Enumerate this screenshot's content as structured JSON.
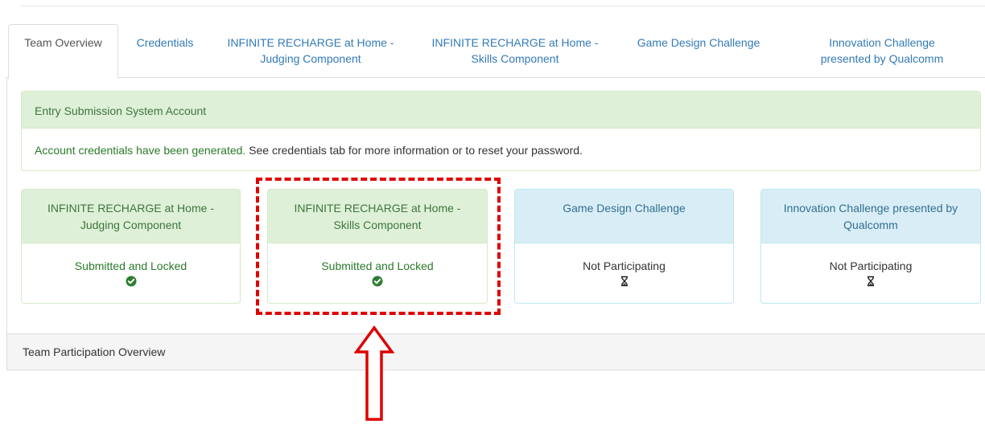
{
  "tabs": [
    {
      "line1": "Team Overview",
      "line2": ""
    },
    {
      "line1": "Credentials",
      "line2": ""
    },
    {
      "line1": "INFINITE RECHARGE at Home -",
      "line2": "Judging Component"
    },
    {
      "line1": "INFINITE RECHARGE at Home -",
      "line2": "Skills Component"
    },
    {
      "line1": "Game Design Challenge",
      "line2": ""
    },
    {
      "line1": "Innovation Challenge",
      "line2": "presented by Qualcomm"
    }
  ],
  "account_panel": {
    "heading": "Entry Submission System Account",
    "success_text": "Account credentials have been generated.",
    "info_text": " See credentials tab for more information or to reset your password."
  },
  "cards": [
    {
      "line1": "INFINITE RECHARGE at Home -",
      "line2": "Judging Component",
      "status": "Submitted and Locked",
      "icon": "check-circle-icon",
      "color": "#3c763d"
    },
    {
      "line1": "INFINITE RECHARGE at Home -",
      "line2": "Skills Component",
      "status": "Submitted and Locked",
      "icon": "check-circle-icon",
      "color": "#3c763d"
    },
    {
      "line1": "Game Design Challenge",
      "line2": "",
      "status": "Not Participating",
      "icon": "hourglass-icon",
      "color": "#31708f"
    },
    {
      "line1": "Innovation Challenge presented by",
      "line2": "Qualcomm",
      "status": "Not Participating",
      "icon": "hourglass-icon",
      "color": "#31708f"
    }
  ],
  "participation_overview": {
    "label": "Team Participation Overview"
  },
  "annotation": {
    "highlight_color": "#e00000"
  }
}
